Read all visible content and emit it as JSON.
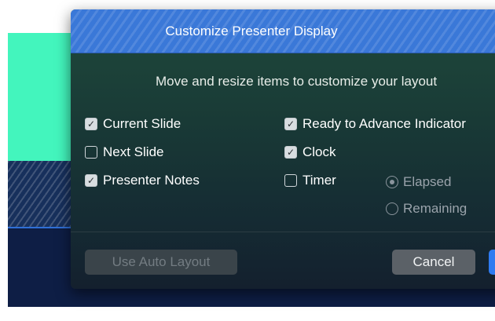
{
  "dialog": {
    "title": "Customize Presenter Display",
    "subtitle": "Move and resize items to customize your layout"
  },
  "options": {
    "current_slide": {
      "label": "Current Slide",
      "checked": true
    },
    "next_slide": {
      "label": "Next Slide",
      "checked": false
    },
    "presenter_notes": {
      "label": "Presenter Notes",
      "checked": true
    },
    "ready_indicator": {
      "label": "Ready to Advance Indicator",
      "checked": true
    },
    "clock": {
      "label": "Clock",
      "checked": true
    },
    "timer": {
      "label": "Timer",
      "checked": false
    }
  },
  "timer_mode": {
    "elapsed": {
      "label": "Elapsed",
      "selected": true
    },
    "remaining": {
      "label": "Remaining",
      "selected": false
    }
  },
  "buttons": {
    "auto_layout": "Use Auto Layout",
    "cancel": "Cancel",
    "ok": ""
  },
  "colors": {
    "titlebar": "#3a78d8",
    "stage_teal": "#43f5bd",
    "stage_navy": "#0e1e45",
    "primary_button": "#2f7bf0"
  },
  "icons": {
    "checked": "checkbox-checked-icon",
    "unchecked": "checkbox-unchecked-icon"
  }
}
